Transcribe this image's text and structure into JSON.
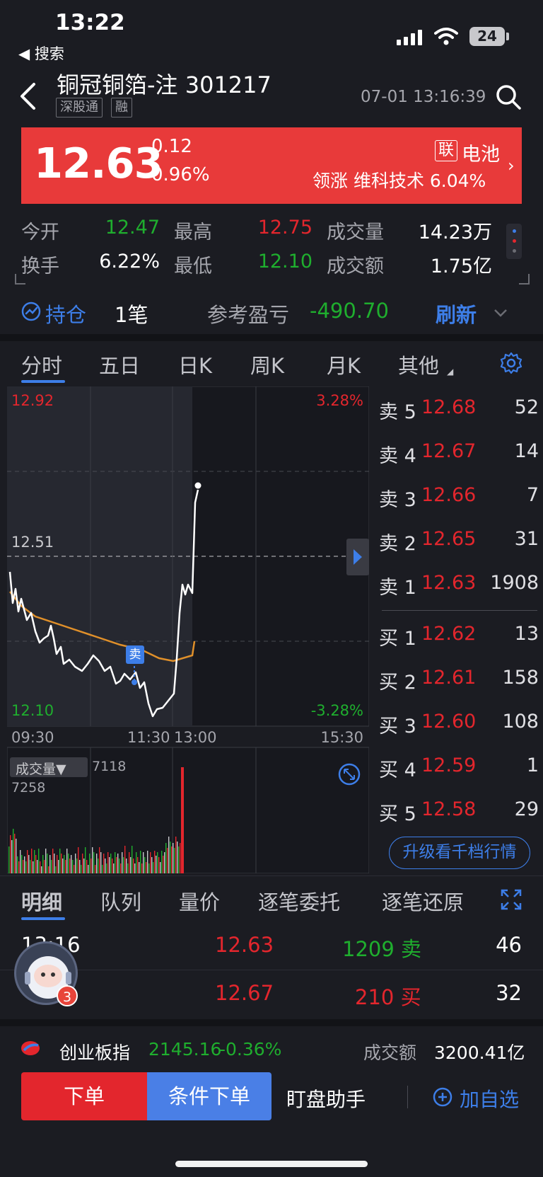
{
  "status_bar": {
    "time": "13:22",
    "back_label": "◀ 搜索",
    "battery": "24"
  },
  "header": {
    "stock_name": "铜冠铜箔-注 301217",
    "tags": [
      "深股通",
      "融"
    ],
    "datetime": "07-01 13:16:39"
  },
  "banner": {
    "price": "12.63",
    "change": "0.12",
    "change_pct": "0.96%",
    "sector_badge": "联",
    "sector_name": "电池",
    "lead_text": "领涨 维科技术 6.04%",
    "bg_color": "#e83a3a"
  },
  "stats": {
    "open_label": "今开",
    "open": "12.47",
    "high_label": "最高",
    "high": "12.75",
    "volume_label": "成交量",
    "volume": "14.23万",
    "turnover_label": "换手",
    "turnover": "6.22%",
    "low_label": "最低",
    "low": "12.10",
    "amount_label": "成交额",
    "amount": "1.75亿"
  },
  "position": {
    "label": "持仓",
    "count": "1笔",
    "pnl_label": "参考盈亏",
    "pnl": "-490.70",
    "refresh": "刷新"
  },
  "tabs": [
    "分时",
    "五日",
    "日K",
    "周K",
    "月K",
    "其他"
  ],
  "chart": {
    "y_top": "12.92",
    "y_top_pct": "3.28%",
    "y_mid": "12.51",
    "y_bottom": "12.10",
    "y_bottom_pct": "-3.28%",
    "x_labels": [
      "09:30",
      "11:30",
      "13:00",
      "15:30"
    ],
    "sell_marker": "卖",
    "volume_label": "成交量▼",
    "volume_value": "7118",
    "volume_max": "7258"
  },
  "order_book": {
    "asks": [
      {
        "label": "卖 5",
        "price": "12.68",
        "qty": "52"
      },
      {
        "label": "卖 4",
        "price": "12.67",
        "qty": "14"
      },
      {
        "label": "卖 3",
        "price": "12.66",
        "qty": "7"
      },
      {
        "label": "卖 2",
        "price": "12.65",
        "qty": "31"
      },
      {
        "label": "卖 1",
        "price": "12.63",
        "qty": "1908"
      }
    ],
    "bids": [
      {
        "label": "买 1",
        "price": "12.62",
        "qty": "13"
      },
      {
        "label": "买 2",
        "price": "12.61",
        "qty": "158"
      },
      {
        "label": "买 3",
        "price": "12.60",
        "qty": "108"
      },
      {
        "label": "买 4",
        "price": "12.59",
        "qty": "1"
      },
      {
        "label": "买 5",
        "price": "12.58",
        "qty": "29"
      }
    ],
    "upgrade_button": "升级看千档行情"
  },
  "bottom_tabs": [
    "明细",
    "队列",
    "量价",
    "逐笔委托",
    "逐笔还原"
  ],
  "trades": [
    {
      "time": "13:16",
      "price": "12.63",
      "qty": "1209 卖",
      "count": "46"
    },
    {
      "time": "",
      "price": "12.67",
      "qty": "210 买",
      "count": "32"
    }
  ],
  "avatar_badge": "3",
  "index": {
    "name": "创业板指",
    "value": "2145.16",
    "change": "-0.36%",
    "amount_label": "成交额",
    "amount": "3200.41亿"
  },
  "actions": {
    "order": "下单",
    "conditional_order": "条件下单",
    "watch_assistant": "盯盘助手",
    "add_watchlist": "加自选"
  }
}
